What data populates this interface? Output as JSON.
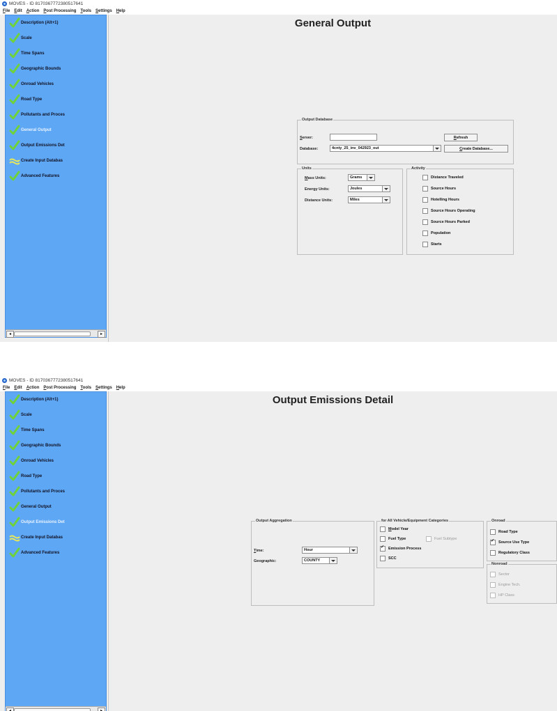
{
  "window_title": "MOVES - ID 8170367772380517641",
  "menu": [
    "File",
    "Edit",
    "Action",
    "Post Processing",
    "Tools",
    "Settings",
    "Help"
  ],
  "nav": {
    "items": [
      {
        "label": "Description (Alt+1)",
        "status": "done"
      },
      {
        "label": "Scale",
        "status": "done"
      },
      {
        "label": "Time Spans",
        "status": "done"
      },
      {
        "label": "Geographic Bounds",
        "status": "done"
      },
      {
        "label": "Onroad Vehicles",
        "status": "done"
      },
      {
        "label": "Road Type",
        "status": "done"
      },
      {
        "label": "Pollutants and Proces",
        "status": "done"
      },
      {
        "label": "General Output",
        "status": "done"
      },
      {
        "label": "Output Emissions Det",
        "status": "done"
      },
      {
        "label": "Create Input Databas",
        "status": "partial"
      },
      {
        "label": "Advanced Features",
        "status": "done"
      }
    ],
    "check_color": "#6fd23b",
    "partial_color": "#e8e85a"
  },
  "screen1": {
    "title": "General Output",
    "output_database": {
      "legend": "Output Database",
      "server_label": "Server:",
      "server_value": "",
      "database_label": "Database:",
      "database_value": "4cnty_25_inv_042923_out",
      "refresh_label": "Refresh",
      "create_db_label": "Create Database..."
    },
    "units": {
      "legend": "Units",
      "mass_label": "Mass Units:",
      "mass_value": "Grams",
      "energy_label": "Energy Units:",
      "energy_value": "Joules",
      "distance_label": "Distance Units:",
      "distance_value": "Miles"
    },
    "activity": {
      "legend": "Activity",
      "items": [
        {
          "label": "Distance Traveled",
          "checked": false
        },
        {
          "label": "Source Hours",
          "checked": false
        },
        {
          "label": "Hotelling Hours",
          "checked": false
        },
        {
          "label": "Source Hours Operating",
          "checked": false
        },
        {
          "label": "Source Hours Parked",
          "checked": false
        },
        {
          "label": "Population",
          "checked": false
        },
        {
          "label": "Starts",
          "checked": false
        }
      ]
    }
  },
  "screen2": {
    "title": "Output Emissions Detail",
    "aggregation": {
      "legend": "Output Aggregation",
      "time_label": "Time:",
      "time_value": "Hour",
      "geo_label": "Geographic:",
      "geo_value": "COUNTY"
    },
    "all_categories": {
      "legend": "for All Vehicle/Equipment Categories",
      "model_year": "Model Year",
      "fuel_type": "Fuel Type",
      "fuel_subtype": "Fuel Subtype",
      "emission_process": "Emission Process",
      "scc": "SCC"
    },
    "onroad": {
      "legend": "Onroad",
      "road_type": "Road Type",
      "source_use_type": "Source Use Type",
      "regulatory_class": "Regulatory Class"
    },
    "nonroad": {
      "legend": "Nonroad",
      "sector": "Sector",
      "engine_tech": "Engine Tech.",
      "hp_class": "HP Class"
    }
  }
}
